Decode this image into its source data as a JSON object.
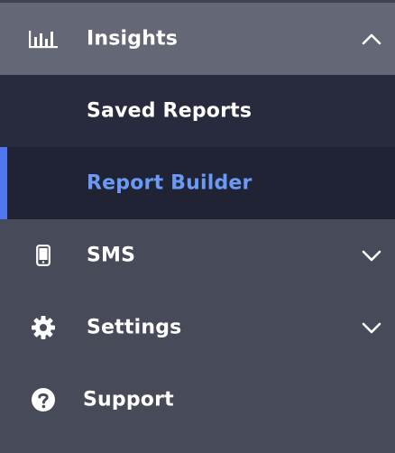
{
  "nav": {
    "insights": {
      "label": "Insights",
      "expanded": true
    },
    "submenu": [
      {
        "label": "Saved Reports",
        "active": false
      },
      {
        "label": "Report Builder",
        "active": true
      }
    ],
    "sms": {
      "label": "SMS"
    },
    "settings": {
      "label": "Settings"
    },
    "support": {
      "label": "Support"
    }
  },
  "colors": {
    "sidebar_bg": "#474b59",
    "insights_bg": "#646876",
    "submenu_bg": "#272b3d",
    "active_bg": "#1f2333",
    "active_accent": "#4f76ec",
    "active_text": "#6a9af6"
  },
  "icons": {
    "insights": "bar-chart-icon",
    "sms": "mobile-phone-icon",
    "settings": "gear-icon",
    "support": "question-circle-icon",
    "expanded": "chevron-up-icon",
    "collapsed": "chevron-down-icon"
  }
}
